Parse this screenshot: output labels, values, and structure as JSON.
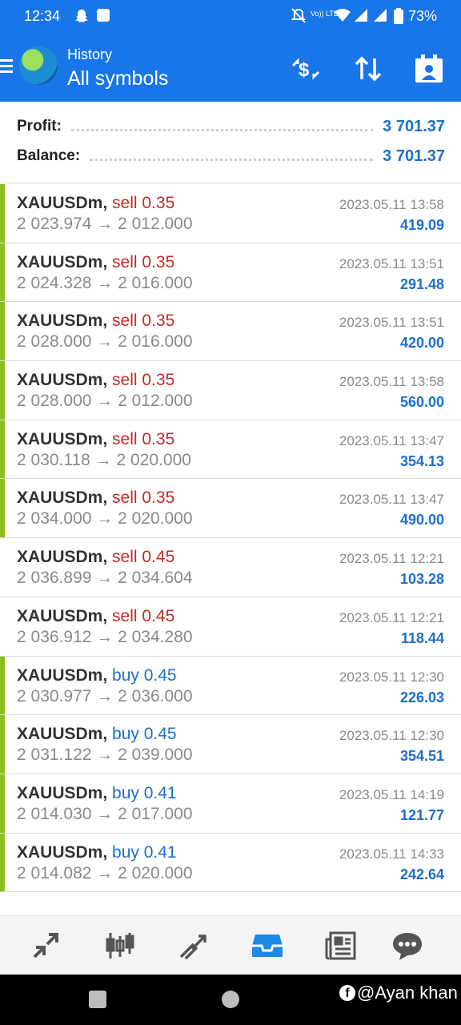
{
  "status_bar": {
    "time": "12:34",
    "battery": "73%",
    "icons": [
      "snapchat-icon",
      "app-icon",
      "mute-icon",
      "volte-icon",
      "wifi-icon",
      "signal-icon",
      "signal-icon",
      "battery-icon"
    ],
    "volte_label": "Vo)) LTE2"
  },
  "header": {
    "subtitle": "History",
    "title": "All symbols",
    "actions": [
      "currency-swap-icon",
      "sort-icon",
      "calendar-icon"
    ]
  },
  "summary": {
    "profit_label": "Profit:",
    "profit_value": "3 701.37",
    "balance_label": "Balance:",
    "balance_value": "3 701.37"
  },
  "deals": [
    {
      "symbol": "XAUUSDm,",
      "side": "sell 0.35",
      "prices": "2 023.974 → 2 012.000",
      "time": "2023.05.11 13:58",
      "profit": "419.09",
      "marker": true,
      "type": "sell"
    },
    {
      "symbol": "XAUUSDm,",
      "side": "sell 0.35",
      "prices": "2 024.328 → 2 016.000",
      "time": "2023.05.11 13:51",
      "profit": "291.48",
      "marker": true,
      "type": "sell"
    },
    {
      "symbol": "XAUUSDm,",
      "side": "sell 0.35",
      "prices": "2 028.000 → 2 016.000",
      "time": "2023.05.11 13:51",
      "profit": "420.00",
      "marker": true,
      "type": "sell"
    },
    {
      "symbol": "XAUUSDm,",
      "side": "sell 0.35",
      "prices": "2 028.000 → 2 012.000",
      "time": "2023.05.11 13:58",
      "profit": "560.00",
      "marker": true,
      "type": "sell"
    },
    {
      "symbol": "XAUUSDm,",
      "side": "sell 0.35",
      "prices": "2 030.118 → 2 020.000",
      "time": "2023.05.11 13:47",
      "profit": "354.13",
      "marker": true,
      "type": "sell"
    },
    {
      "symbol": "XAUUSDm,",
      "side": "sell 0.35",
      "prices": "2 034.000 → 2 020.000",
      "time": "2023.05.11 13:47",
      "profit": "490.00",
      "marker": true,
      "type": "sell"
    },
    {
      "symbol": "XAUUSDm,",
      "side": "sell 0.45",
      "prices": "2 036.899 → 2 034.604",
      "time": "2023.05.11 12:21",
      "profit": "103.28",
      "marker": false,
      "type": "sell"
    },
    {
      "symbol": "XAUUSDm,",
      "side": "sell 0.45",
      "prices": "2 036.912 → 2 034.280",
      "time": "2023.05.11 12:21",
      "profit": "118.44",
      "marker": false,
      "type": "sell"
    },
    {
      "symbol": "XAUUSDm,",
      "side": "buy 0.45",
      "prices": "2 030.977 → 2 036.000",
      "time": "2023.05.11 12:30",
      "profit": "226.03",
      "marker": true,
      "type": "buy"
    },
    {
      "symbol": "XAUUSDm,",
      "side": "buy 0.45",
      "prices": "2 031.122 → 2 039.000",
      "time": "2023.05.11 12:30",
      "profit": "354.51",
      "marker": true,
      "type": "buy"
    },
    {
      "symbol": "XAUUSDm,",
      "side": "buy 0.41",
      "prices": "2 014.030 → 2 017.000",
      "time": "2023.05.11 14:19",
      "profit": "121.77",
      "marker": true,
      "type": "buy"
    },
    {
      "symbol": "XAUUSDm,",
      "side": "buy 0.41",
      "prices": "2 014.082 → 2 020.000",
      "time": "2023.05.11 14:33",
      "profit": "242.64",
      "marker": true,
      "type": "buy"
    }
  ],
  "bottom_nav": [
    {
      "icon": "quotes-icon",
      "active": false
    },
    {
      "icon": "chart-candles-icon",
      "active": false
    },
    {
      "icon": "trade-icon",
      "active": false
    },
    {
      "icon": "history-inbox-icon",
      "active": true
    },
    {
      "icon": "news-icon",
      "active": false
    },
    {
      "icon": "chat-icon",
      "active": false
    }
  ],
  "watermark": {
    "text": "@Ayan khan"
  },
  "colors": {
    "header_blue": "#1976e8",
    "sell_red": "#c62828",
    "buy_blue": "#1b6fcf",
    "marker_green": "#8bbf1a",
    "nav_active": "#1e88e5",
    "nav_inactive": "#555555"
  }
}
